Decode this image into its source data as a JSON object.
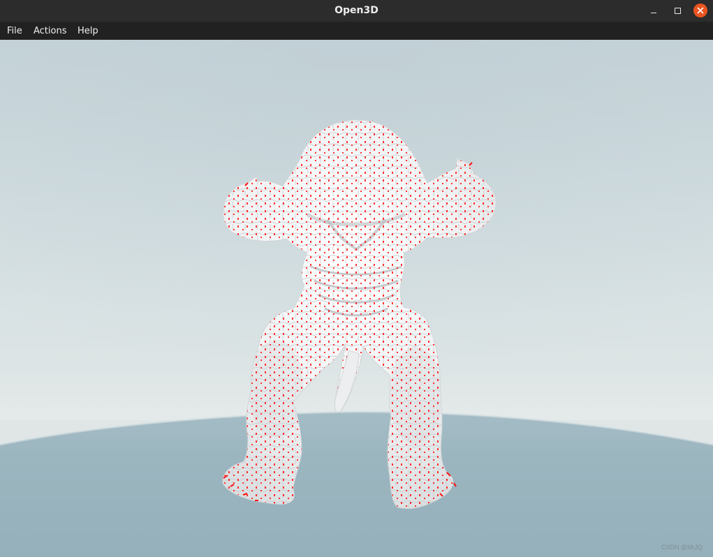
{
  "window": {
    "title": "Open3D",
    "buttons": [
      "minimize",
      "maximize",
      "close"
    ]
  },
  "menu": {
    "items": [
      "File",
      "Actions",
      "Help"
    ]
  },
  "viewport": {
    "sky_color": "#c7d5d9",
    "ground_color": "#9ab5bf",
    "mesh_color": "#eef0f1",
    "feature_point_color": "#ff0000",
    "watermark": "CSDN @MrJQ"
  },
  "icons": {
    "minimize": "minimize-icon",
    "maximize": "maximize-icon",
    "close": "close-icon"
  }
}
